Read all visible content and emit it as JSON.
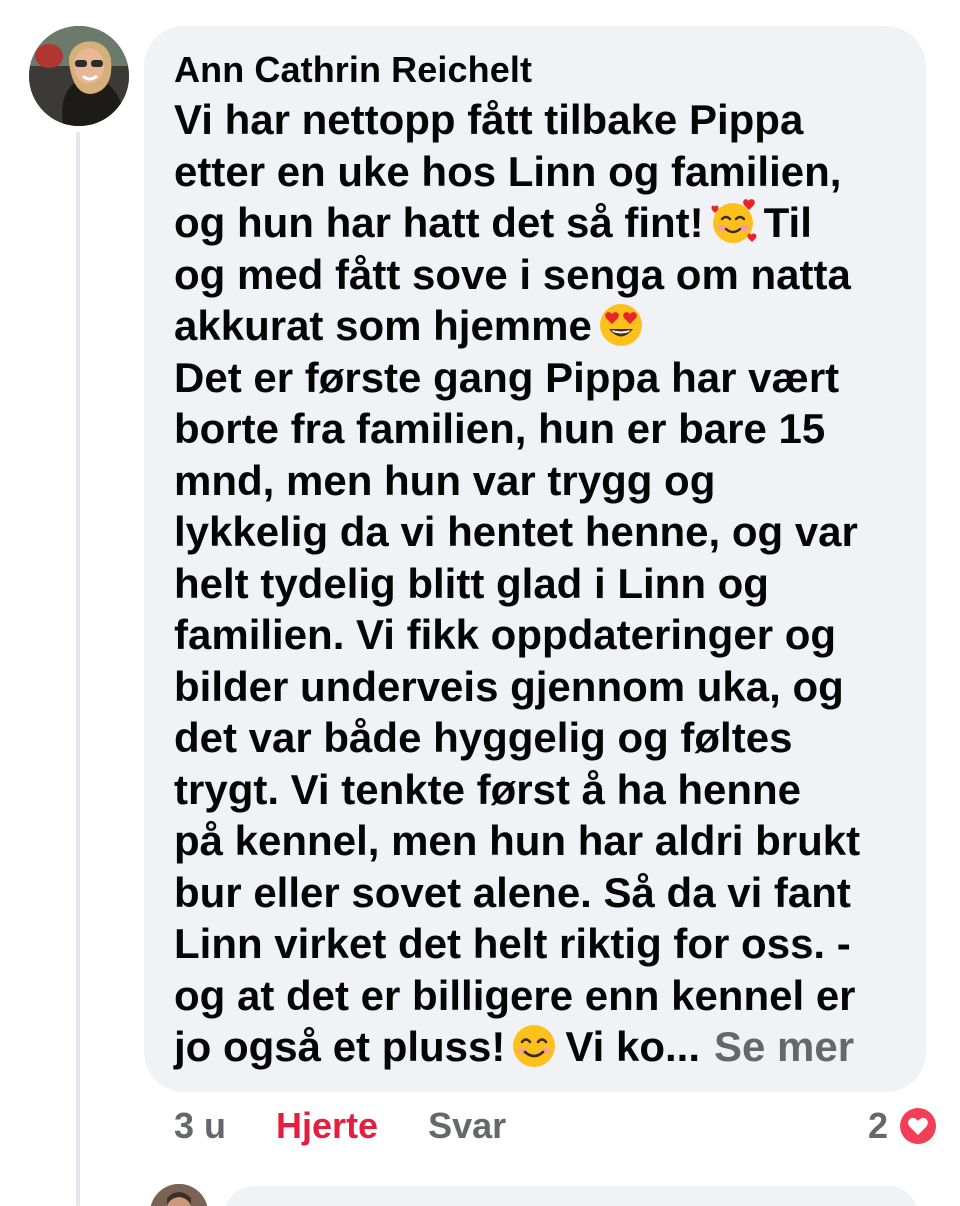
{
  "comment": {
    "author": "Ann Cathrin Reichelt",
    "lines": [
      "Vi har nettopp fått tilbake Pippa",
      "etter en uke hos Linn og familien,",
      {
        "before": "og hun har hatt det så fint!",
        "emoji": "smiling-face-with-hearts",
        "after": "Til"
      },
      "og med fått sove i senga om natta",
      {
        "before": "akkurat som hjemme",
        "emoji": "heart-eyes",
        "after": ""
      },
      "Det er første gang Pippa har vært",
      "borte fra familien, hun er bare 15",
      "mnd, men hun var trygg og",
      "lykkelig da vi hentet henne, og var",
      "helt tydelig blitt glad i Linn og",
      "familien. Vi fikk oppdateringer og",
      "bilder underveis gjennom uka, og",
      "det var både hyggelig og føltes",
      "trygt. Vi tenkte først å ha henne",
      "på kennel, men hun har aldri brukt",
      "bur eller sovet alene. Så da vi fant",
      "Linn virket det helt riktig for oss. -",
      "og at det er billigere enn kennel er",
      {
        "before": "jo også et pluss!",
        "emoji": "smiling-face",
        "after": "Vi ko...",
        "see_more": "Se mer"
      }
    ],
    "line_texts": {
      "l1": "Vi har nettopp fått tilbake Pippa",
      "l2": "etter en uke hos Linn og familien,",
      "l3a": "og hun har hatt det så fint!",
      "l3b": "Til",
      "l4": "og med fått sove i senga om natta",
      "l5a": "akkurat som hjemme",
      "l6": "Det er første gang Pippa har vært",
      "l7": "borte fra familien, hun er bare 15",
      "l8": "mnd, men hun var trygg og",
      "l9": "lykkelig da vi hentet henne, og var",
      "l10": "helt tydelig blitt glad i Linn og",
      "l11": "familien. Vi fikk oppdateringer og",
      "l12": "bilder underveis gjennom uka, og",
      "l13": "det var både hyggelig og føltes",
      "l14": "trygt. Vi tenkte først å ha henne",
      "l15": "på kennel, men hun har aldri brukt",
      "l16": "bur eller sovet alene. Så da vi fant",
      "l17": "Linn virket det helt riktig for oss. -",
      "l18": "og at det er billigere enn kennel er",
      "l19a": "jo også et pluss!",
      "l19b": "Vi ko...",
      "see_more": "Se mer"
    },
    "timestamp": "3 u",
    "love_label": "Hjerte",
    "reply_label": "Svar",
    "reaction_count": "2",
    "reaction_type": "love-icon"
  },
  "colors": {
    "bubble_bg": "#f0f2f5",
    "text": "#050505",
    "secondary_text": "#65676b",
    "love_red": "#e41e3f",
    "thread_line": "#e4e6eb"
  }
}
